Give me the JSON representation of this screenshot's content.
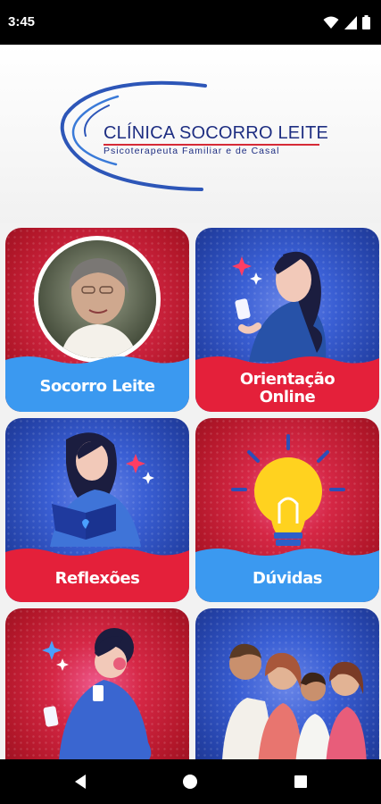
{
  "status_bar": {
    "time": "3:45",
    "icons": [
      "wifi-icon",
      "cellular-signal-icon",
      "battery-icon"
    ]
  },
  "header": {
    "title": "CLÍNICA SOCORRO LEITE",
    "subtitle": "Psicoterapeuta Familiar e de Casal"
  },
  "cards": [
    {
      "label": "Socorro Leite",
      "theme": "red"
    },
    {
      "label_lines": [
        "Orientação",
        "Online"
      ],
      "theme": "blue"
    },
    {
      "label": "Reflexões",
      "theme": "blue"
    },
    {
      "label": "Dúvidas",
      "theme": "red"
    },
    {
      "label": "",
      "theme": "red"
    },
    {
      "label": "",
      "theme": "blue"
    }
  ],
  "colors": {
    "red": "#e4203a",
    "blue": "#3b99f0",
    "navy": "#1e2e82"
  },
  "nav_bar": {
    "buttons": [
      "back-triangle-icon",
      "home-circle-icon",
      "recents-square-icon"
    ]
  }
}
